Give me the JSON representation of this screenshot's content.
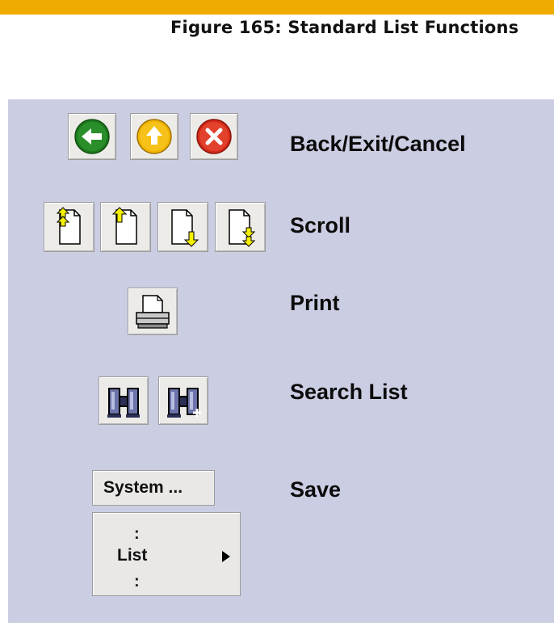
{
  "figure": {
    "title": "Figure 165: Standard List Functions"
  },
  "rows": {
    "back_exit_cancel": {
      "label": "Back/Exit/Cancel",
      "buttons": [
        "back-icon",
        "exit-icon",
        "cancel-icon"
      ],
      "colors": {
        "back": "#1f7a1f",
        "exit": "#f0b400",
        "cancel": "#d42a1a"
      }
    },
    "scroll": {
      "label": "Scroll",
      "buttons": [
        "first-page-icon",
        "previous-page-icon",
        "next-page-icon",
        "last-page-icon"
      ]
    },
    "print": {
      "label": "Print",
      "buttons": [
        "printer-icon"
      ]
    },
    "search_list": {
      "label": "Search List",
      "buttons": [
        "binoculars-icon",
        "binoculars-plus-icon"
      ]
    },
    "save": {
      "label": "Save",
      "system_button": "System ...",
      "menu": {
        "dots_top": ":",
        "item": "List",
        "dots_bottom": ":"
      }
    }
  },
  "colors": {
    "accent_bar": "#f0ab00",
    "panel_bg": "#cbcde2",
    "arrow_yellow": "#f4f000"
  }
}
